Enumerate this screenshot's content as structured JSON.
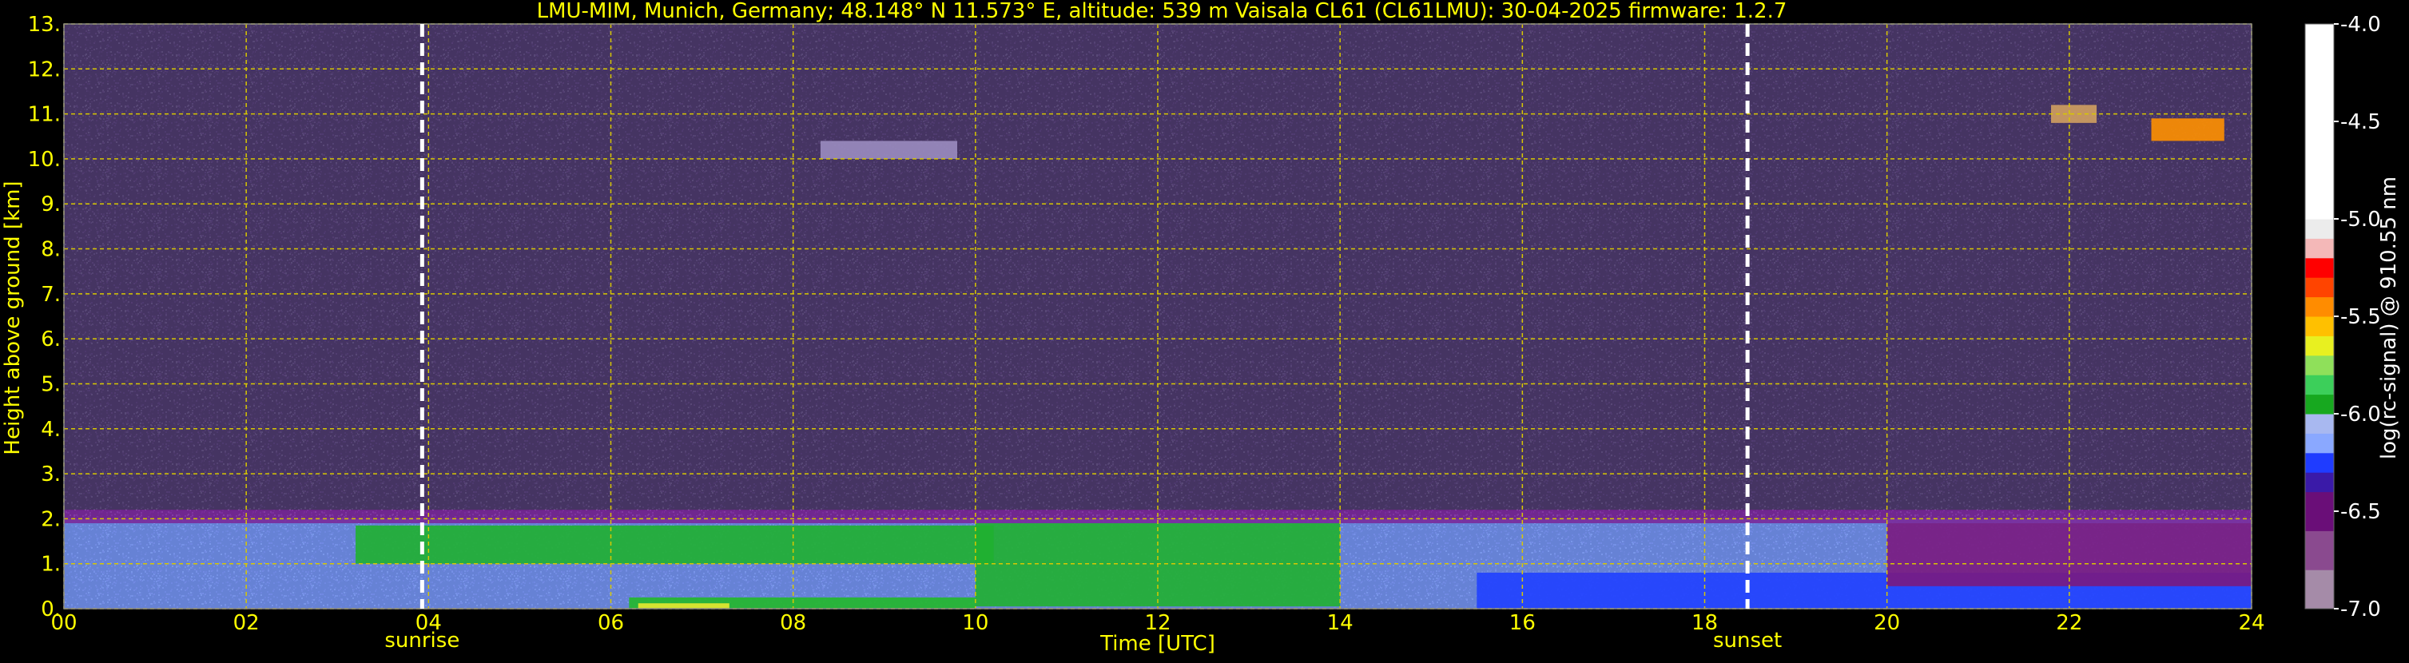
{
  "chart_data": {
    "type": "heatmap",
    "title": "LMU-MIM, Munich, Germany; 48.148° N 11.573° E, altitude: 539 m    Vaisala CL61 (CL61LMU): 30-04-2025    firmware: 1.2.7",
    "xlabel": "Time [UTC]",
    "ylabel": "Height above ground [km]",
    "xlim": [
      0,
      24
    ],
    "ylim": [
      0,
      13
    ],
    "x_ticks": [
      {
        "value": 0,
        "label": "00"
      },
      {
        "value": 2,
        "label": "02"
      },
      {
        "value": 4,
        "label": "04"
      },
      {
        "value": 6,
        "label": "06"
      },
      {
        "value": 8,
        "label": "08"
      },
      {
        "value": 10,
        "label": "10"
      },
      {
        "value": 12,
        "label": "12"
      },
      {
        "value": 14,
        "label": "14"
      },
      {
        "value": 16,
        "label": "16"
      },
      {
        "value": 18,
        "label": "18"
      },
      {
        "value": 20,
        "label": "20"
      },
      {
        "value": 22,
        "label": "22"
      },
      {
        "value": 24,
        "label": "24"
      }
    ],
    "y_ticks": [
      {
        "value": 0,
        "label": "0."
      },
      {
        "value": 1,
        "label": "1."
      },
      {
        "value": 2,
        "label": "2."
      },
      {
        "value": 3,
        "label": "3."
      },
      {
        "value": 4,
        "label": "4."
      },
      {
        "value": 5,
        "label": "5."
      },
      {
        "value": 6,
        "label": "6."
      },
      {
        "value": 7,
        "label": "7."
      },
      {
        "value": 8,
        "label": "8."
      },
      {
        "value": 9,
        "label": "9."
      },
      {
        "value": 10,
        "label": "10."
      },
      {
        "value": 11,
        "label": "11."
      },
      {
        "value": 12,
        "label": "12."
      },
      {
        "value": 13,
        "label": "13."
      }
    ],
    "grid": true,
    "annotations": [
      {
        "x": 3.93,
        "label": "sunrise"
      },
      {
        "x": 18.47,
        "label": "sunset"
      }
    ],
    "colorbar": {
      "label": "log(rc-signal) @ 910.55 nm",
      "range": [
        -7.0,
        -4.0
      ],
      "ticks": [
        {
          "value": -4.0,
          "label": "-4.0"
        },
        {
          "value": -4.5,
          "label": "-4.5"
        },
        {
          "value": -5.0,
          "label": "-5.0"
        },
        {
          "value": -5.5,
          "label": "-5.5"
        },
        {
          "value": -6.0,
          "label": "-6.0"
        },
        {
          "value": -6.5,
          "label": "-6.5"
        },
        {
          "value": -7.0,
          "label": "-7.0"
        }
      ],
      "colors": [
        {
          "from": -7.0,
          "to": -6.8,
          "color": "#a58ba8"
        },
        {
          "from": -6.8,
          "to": -6.6,
          "color": "#8a4a8f"
        },
        {
          "from": -6.6,
          "to": -6.4,
          "color": "#6a0e78"
        },
        {
          "from": -6.4,
          "to": -6.3,
          "color": "#3a1aa8"
        },
        {
          "from": -6.3,
          "to": -6.2,
          "color": "#1f3cff"
        },
        {
          "from": -6.2,
          "to": -6.1,
          "color": "#8aa8ff"
        },
        {
          "from": -6.1,
          "to": -6.0,
          "color": "#a8b8f0"
        },
        {
          "from": -6.0,
          "to": -5.9,
          "color": "#17a81f"
        },
        {
          "from": -5.9,
          "to": -5.8,
          "color": "#3ccf5a"
        },
        {
          "from": -5.8,
          "to": -5.7,
          "color": "#8fe05a"
        },
        {
          "from": -5.7,
          "to": -5.6,
          "color": "#e8f020"
        },
        {
          "from": -5.6,
          "to": -5.5,
          "color": "#ffc000"
        },
        {
          "from": -5.5,
          "to": -5.4,
          "color": "#ff8c00"
        },
        {
          "from": -5.4,
          "to": -5.3,
          "color": "#ff4400"
        },
        {
          "from": -5.3,
          "to": -5.2,
          "color": "#ff0000"
        },
        {
          "from": -5.2,
          "to": -5.1,
          "color": "#f4b8b8"
        },
        {
          "from": -5.1,
          "to": -5.0,
          "color": "#ececec"
        },
        {
          "from": -5.0,
          "to": -4.0,
          "color": "#ffffff"
        }
      ]
    },
    "layers": [
      {
        "name": "background noise",
        "x_range": [
          0,
          24
        ],
        "y_range": [
          2.2,
          13
        ],
        "color": "#4a3868"
      },
      {
        "name": "aerosol layer",
        "x_range": [
          0,
          24
        ],
        "y_range": [
          0,
          2.0
        ],
        "color": "#6f8fe8"
      },
      {
        "name": "layer top",
        "x_range": [
          0,
          24
        ],
        "y_range": [
          1.9,
          2.2
        ],
        "color": "#7a2a9a"
      },
      {
        "name": "enhanced layer",
        "x_range": [
          3.2,
          10.2
        ],
        "y_range": [
          1.0,
          1.85
        ],
        "color": "#1fb030"
      },
      {
        "name": "enhanced layer",
        "x_range": [
          10.0,
          14.0
        ],
        "y_range": [
          0.05,
          1.9
        ],
        "color": "#20b030"
      },
      {
        "name": "surface layer",
        "x_range": [
          6.2,
          10.0
        ],
        "y_range": [
          0,
          0.25
        ],
        "color": "#22b82a"
      },
      {
        "name": "surface layer",
        "x_range": [
          6.3,
          7.3
        ],
        "y_range": [
          0,
          0.12
        ],
        "color": "#e8e830"
      },
      {
        "name": "lower layer",
        "x_range": [
          15.5,
          24
        ],
        "y_range": [
          0,
          0.8
        ],
        "color": "#2040ff"
      },
      {
        "name": "residual layer",
        "x_range": [
          20.0,
          24
        ],
        "y_range": [
          0.5,
          1.9
        ],
        "color": "#7a1a80"
      },
      {
        "name": "cirrus",
        "x_range": [
          22.9,
          23.7
        ],
        "y_range": [
          10.4,
          10.9
        ],
        "color": "#ff9000"
      },
      {
        "name": "cirrus",
        "x_range": [
          21.8,
          22.3
        ],
        "y_range": [
          10.8,
          11.2
        ],
        "color": "#d0a060"
      },
      {
        "name": "thin cloud",
        "x_range": [
          8.3,
          9.8
        ],
        "y_range": [
          10.0,
          10.4
        ],
        "color": "#9a8cc0"
      }
    ]
  }
}
